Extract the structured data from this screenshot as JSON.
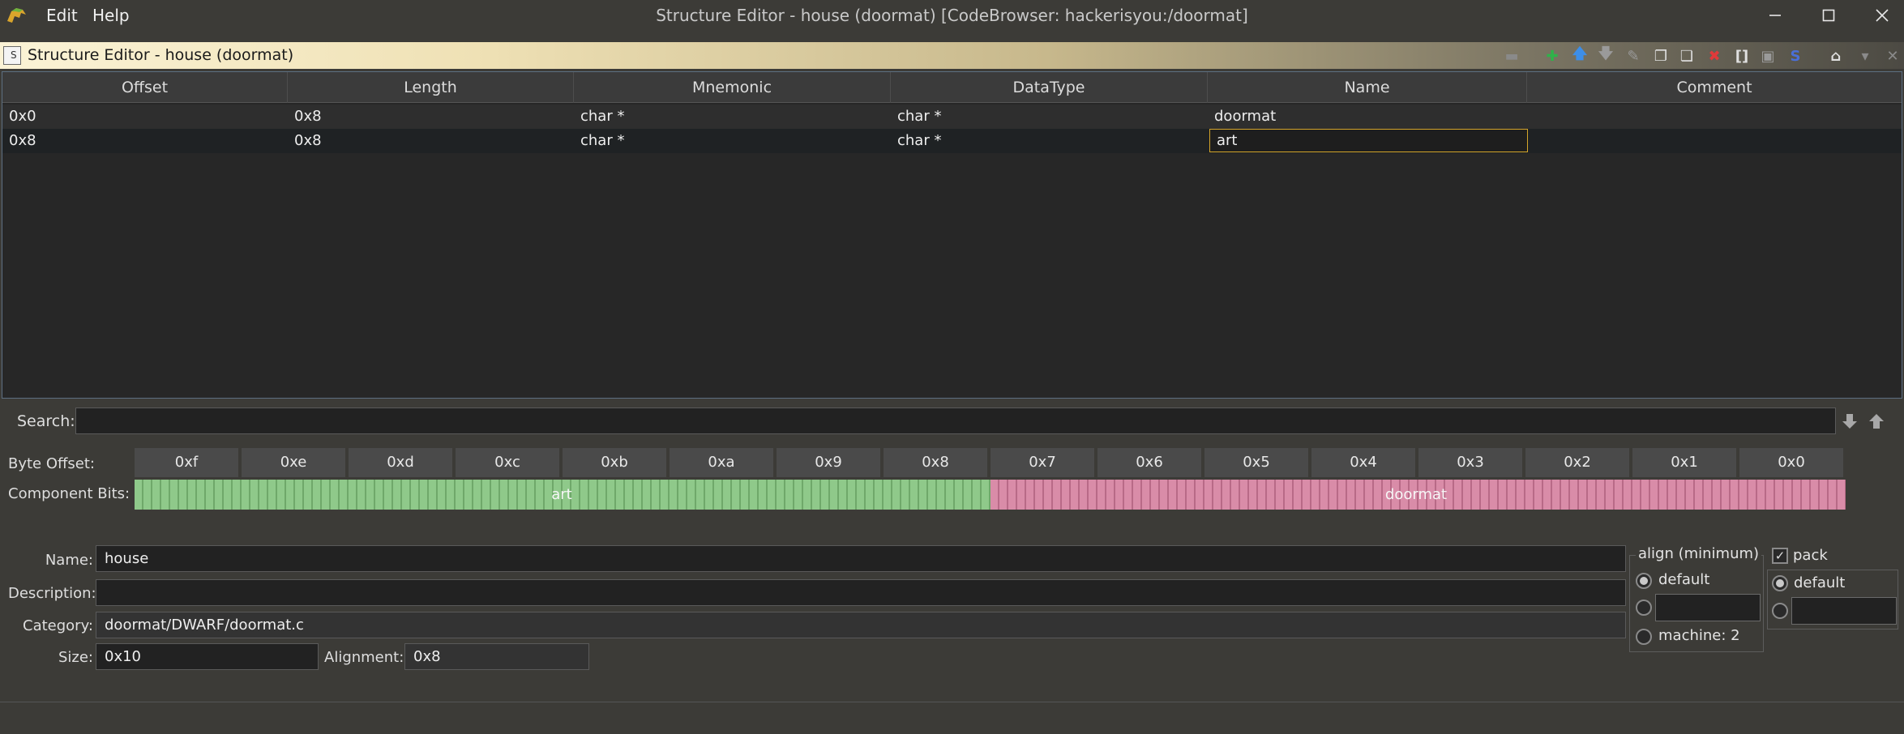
{
  "window": {
    "title": "Structure Editor - house (doormat) [CodeBrowser: hackerisyou:/doormat]",
    "menu": [
      "Edit",
      "Help"
    ],
    "controls": [
      "minimize",
      "maximize",
      "close"
    ]
  },
  "component": {
    "title": "Structure Editor - house (doormat)",
    "icon_text": "S",
    "toolbar": [
      {
        "name": "apply-icon",
        "glyph": "▬",
        "color": "#8a8a8a"
      },
      {
        "name": "insert-undefined-icon",
        "glyph": "✚",
        "color": "#2fb24a"
      },
      {
        "name": "move-up-icon",
        "glyph": "🡅",
        "color": "#3d8ee8"
      },
      {
        "name": "move-down-icon",
        "glyph": "🡇",
        "color": "#9a9a9a"
      },
      {
        "name": "edit-field-icon",
        "glyph": "✎",
        "color": "#9a9a9a"
      },
      {
        "name": "duplicate-icon",
        "glyph": "❐",
        "color": "#e0e0e0"
      },
      {
        "name": "duplicate-multiple-icon",
        "glyph": "❏",
        "color": "#e0e0e0"
      },
      {
        "name": "delete-icon",
        "glyph": "✖",
        "color": "#e03a3a"
      },
      {
        "name": "array-icon",
        "glyph": "[]",
        "color": "#e0e0e0"
      },
      {
        "name": "unpackage-icon",
        "glyph": "▣",
        "color": "#9a9a9a"
      },
      {
        "name": "show-component-path-icon",
        "glyph": "S",
        "color": "#4a6fd8"
      },
      {
        "name": "home-icon",
        "glyph": "⌂",
        "color": "#e0e0e0"
      },
      {
        "name": "menu-dropdown-icon",
        "glyph": "▾",
        "color": "#8a8a8a"
      },
      {
        "name": "close-icon",
        "glyph": "✕",
        "color": "#8a8a8a"
      }
    ]
  },
  "table": {
    "columns": [
      "Offset",
      "Length",
      "Mnemonic",
      "DataType",
      "Name",
      "Comment"
    ],
    "rows": [
      {
        "offset": "0x0",
        "length": "0x8",
        "mnemonic": "char *",
        "datatype": "char *",
        "name": "doormat",
        "comment": ""
      },
      {
        "offset": "0x8",
        "length": "0x8",
        "mnemonic": "char *",
        "datatype": "char *",
        "name": "art",
        "comment": ""
      }
    ]
  },
  "search": {
    "label": "Search:",
    "value": ""
  },
  "bitview": {
    "byte_offset_label": "Byte Offset:",
    "component_bits_label": "Component Bits:",
    "bytes": [
      "0xf",
      "0xe",
      "0xd",
      "0xc",
      "0xb",
      "0xa",
      "0x9",
      "0x8",
      "0x7",
      "0x6",
      "0x5",
      "0x4",
      "0x3",
      "0x2",
      "0x1",
      "0x0"
    ],
    "components": [
      {
        "name": "art",
        "color": "#8fc98a"
      },
      {
        "name": "doormat",
        "color": "#d98ca8"
      }
    ]
  },
  "form": {
    "name_label": "Name:",
    "name_value": "house",
    "description_label": "Description:",
    "description_value": "",
    "category_label": "Category:",
    "category_value": "doormat/DWARF/doormat.c",
    "size_label": "Size:",
    "size_value": "0x10",
    "alignment_label": "Alignment:",
    "alignment_value": "0x8"
  },
  "align": {
    "title": "align (minimum)",
    "default_label": "default",
    "machine_label": "machine: 2"
  },
  "pack": {
    "title": "pack",
    "checked": true,
    "default_label": "default"
  }
}
